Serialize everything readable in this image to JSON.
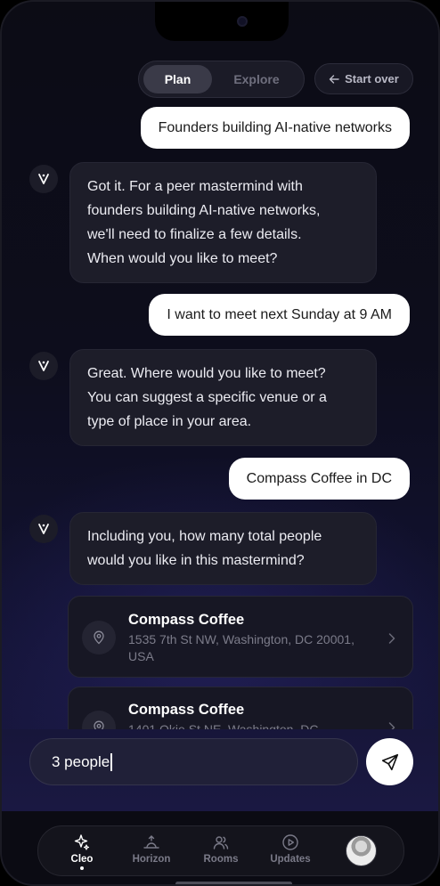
{
  "header": {
    "tabs": [
      {
        "label": "Plan",
        "active": true
      },
      {
        "label": "Explore",
        "active": false
      }
    ],
    "start_over_label": "Start over"
  },
  "messages": [
    {
      "role": "user",
      "text": "Founders building AI-native networks"
    },
    {
      "role": "bot",
      "lines": [
        "Got it. For a peer mastermind with",
        "founders building AI-native networks,",
        "we'll need to finalize a few details.",
        "When would you like to meet?"
      ]
    },
    {
      "role": "user",
      "text": "I want to meet next Sunday at 9 AM"
    },
    {
      "role": "bot",
      "lines": [
        "Great. Where would you like to meet?",
        "You can suggest a specific venue or a",
        "type of place in your area."
      ]
    },
    {
      "role": "user",
      "text": "Compass Coffee in DC"
    },
    {
      "role": "bot",
      "lines": [
        "Including you, how many total people",
        "would you like in this mastermind?"
      ]
    }
  ],
  "venues": [
    {
      "name": "Compass Coffee",
      "address": "1535 7th St NW, Washington, DC 20001, USA"
    },
    {
      "name": "Compass Coffee",
      "address": "1401 Okie St NE, Washington, DC"
    }
  ],
  "composer": {
    "value": "3 people"
  },
  "nav": {
    "items": [
      {
        "label": "Cleo",
        "icon": "sparkle-icon",
        "active": true
      },
      {
        "label": "Horizon",
        "icon": "sunrise-icon",
        "active": false
      },
      {
        "label": "Rooms",
        "icon": "people-icon",
        "active": false
      },
      {
        "label": "Updates",
        "icon": "play-circle-icon",
        "active": false
      }
    ]
  },
  "colors": {
    "background": "#0d0d1c",
    "user_bubble": "#ffffff",
    "bot_bubble": "#1d1d29",
    "accent": "#ffffff"
  }
}
